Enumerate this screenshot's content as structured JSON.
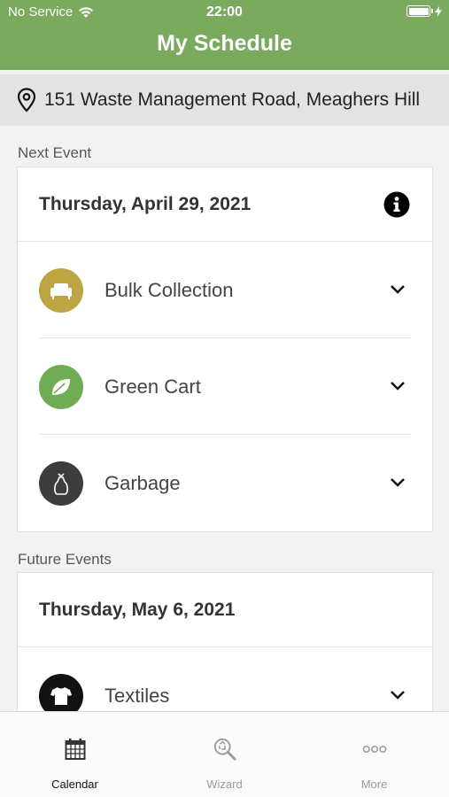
{
  "status_bar": {
    "carrier": "No Service",
    "time": "22:00"
  },
  "header": {
    "title": "My Schedule"
  },
  "address": {
    "text": "151 Waste Management Road, Meaghers Hill",
    "icon": "map-pin-icon"
  },
  "next_event": {
    "section_label": "Next Event",
    "date": "Thursday, April 29, 2021",
    "items": [
      {
        "label": "Bulk Collection",
        "icon": "sofa-icon",
        "color": "#bea543"
      },
      {
        "label": "Green Cart",
        "icon": "leaf-icon",
        "color": "#6fac54"
      },
      {
        "label": "Garbage",
        "icon": "garbage-bag-icon",
        "color": "#3d3d3d"
      }
    ]
  },
  "future_events": {
    "section_label": "Future Events",
    "date": "Thursday, May 6, 2021",
    "items": [
      {
        "label": "Textiles",
        "icon": "tshirt-icon",
        "color": "#111111"
      }
    ]
  },
  "tab_bar": {
    "tabs": [
      {
        "label": "Calendar",
        "icon": "calendar-icon",
        "active": true
      },
      {
        "label": "Wizard",
        "icon": "wizard-search-icon",
        "active": false
      },
      {
        "label": "More",
        "icon": "more-dots-icon",
        "active": false
      }
    ]
  },
  "colors": {
    "header_green": "#79aa5e",
    "address_bg": "#e3e3e3"
  }
}
